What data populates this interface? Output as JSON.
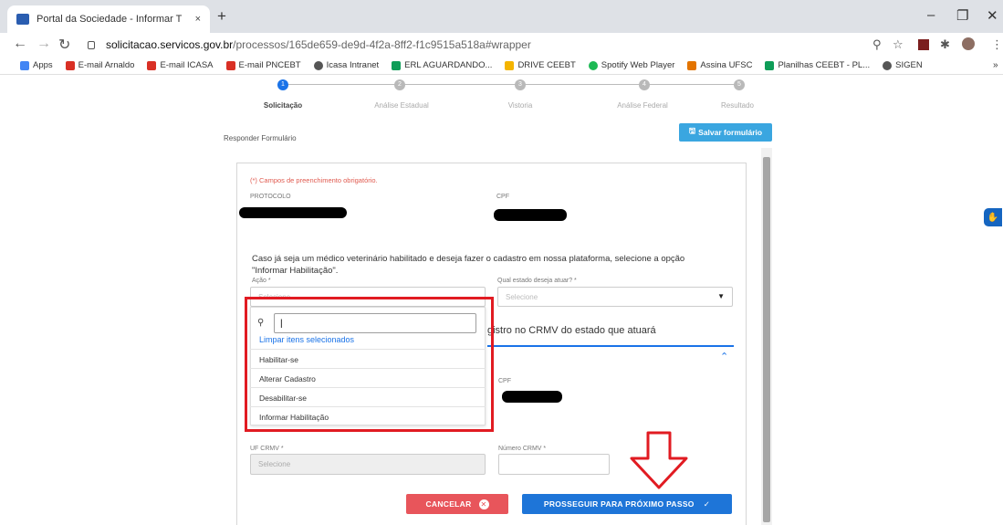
{
  "browser": {
    "tab_title": "Portal da Sociedade - Informar T",
    "tab_close": "×",
    "new_tab": "+",
    "url_domain": "solicitacao.servicos.gov.br",
    "url_path": "/processos/165de659-de9d-4f2a-8ff2-f1c9515a518a#wrapper",
    "bookmarks": [
      {
        "label": "Apps",
        "color": "#4285f4"
      },
      {
        "label": "E-mail Arnaldo",
        "color": "#d93025"
      },
      {
        "label": "E-mail ICASA",
        "color": "#d93025"
      },
      {
        "label": "E-mail PNCEBT",
        "color": "#d93025"
      },
      {
        "label": "Icasa Intranet",
        "color": "#555555"
      },
      {
        "label": "ERL AGUARDANDO...",
        "color": "#0f9d58"
      },
      {
        "label": "DRIVE CEEBT",
        "color": "#f4b400"
      },
      {
        "label": "Spotify Web Player",
        "color": "#1db954"
      },
      {
        "label": "Assina UFSC",
        "color": "#e37400"
      },
      {
        "label": "Planilhas CEEBT - PL...",
        "color": "#0f9d58"
      },
      {
        "label": "SIGEN",
        "color": "#555555"
      }
    ]
  },
  "stepper": {
    "steps": [
      {
        "num": "1",
        "label": "Solicitação"
      },
      {
        "num": "2",
        "label": "Análise Estadual"
      },
      {
        "num": "3",
        "label": "Vistoria"
      },
      {
        "num": "4",
        "label": "Análise Federal"
      },
      {
        "num": "5",
        "label": "Resultado"
      }
    ]
  },
  "page": {
    "respond_label": "Responder Formulário",
    "save_button": "Salvar formulário",
    "required_note": "(*) Campos de preenchimento obrigatório.",
    "protocol_label": "PROTOCOLO",
    "cpf_label": "CPF",
    "info_text": "Caso já seja um médico veterinário habilitado e deseja fazer o cadastro em nossa plataforma, selecione a opção \"Informar Habilitação\".",
    "action_label": "Ação *",
    "state_label": "Qual estado deseja atuar? *",
    "select_placeholder": "Selecione",
    "section_title": "gistro no CRMV do estado que atuará",
    "cpf_label_2": "CPF",
    "uf_crmv_label": "UF CRMV *",
    "crmv_number_label": "Número CRMV *",
    "cancel_button": "CANCELAR",
    "next_button": "PROSSEGUIR PARA PRÓXIMO PASSO"
  },
  "dropdown": {
    "search_value": "|",
    "clear_label": "Limpar itens selecionados",
    "options": [
      "Habilitar-se",
      "Alterar Cadastro",
      "Desabilitar-se",
      "Informar Habilitação"
    ]
  },
  "colors": {
    "accent": "#1a73e8",
    "highlight_box": "#e11b22",
    "cancel": "#e8555b",
    "primary": "#1e75d8"
  }
}
